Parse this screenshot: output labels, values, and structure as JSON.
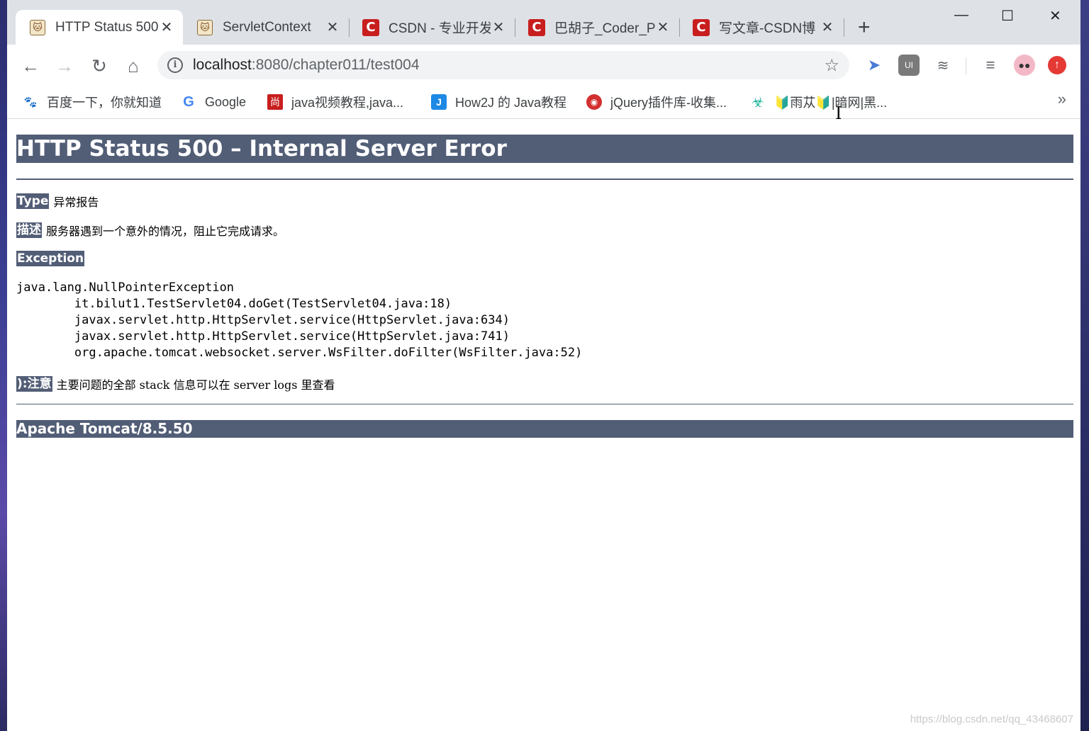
{
  "browser": {
    "tabs": [
      {
        "title": "HTTP Status 500",
        "icon": "tomcat-cat-icon",
        "active": true
      },
      {
        "title": "ServletContext",
        "icon": "tomcat-cat-icon",
        "active": false
      },
      {
        "title": "CSDN - 专业开发",
        "icon": "csdn-icon",
        "active": false
      },
      {
        "title": "巴胡子_Coder_P",
        "icon": "csdn-icon",
        "active": false
      },
      {
        "title": "写文章-CSDN博",
        "icon": "csdn-icon",
        "active": false
      }
    ],
    "new_tab": "+",
    "window_controls": {
      "minimize": "—",
      "maximize": "☐",
      "close": "✕"
    },
    "address": {
      "host": "localhost",
      "path": ":8080/chapter011/test004"
    },
    "bookmarks": [
      {
        "label": "百度一下，你就知道",
        "icon": "baidu-paw-icon"
      },
      {
        "label": "Google",
        "icon": "google-g-icon"
      },
      {
        "label": "java视频教程,java...",
        "icon": "shang-icon"
      },
      {
        "label": "How2J 的 Java教程",
        "icon": "how2j-icon"
      },
      {
        "label": "jQuery插件库-收集...",
        "icon": "jquery-lib-icon"
      },
      {
        "label": "🔰雨苁🔰|暗网|黑...",
        "icon": "biohazard-icon"
      }
    ],
    "bookmarks_overflow": "»"
  },
  "page": {
    "title": "HTTP Status 500 – Internal Server Error",
    "type_label": "Type",
    "type_value": "异常报告",
    "desc_label": "描述",
    "desc_value": "服务器遇到一个意外的情况，阻止它完成请求。",
    "exception_label": "Exception",
    "stack_trace": "java.lang.NullPointerException\n\tit.bilut1.TestServlet04.doGet(TestServlet04.java:18)\n\tjavax.servlet.http.HttpServlet.service(HttpServlet.java:634)\n\tjavax.servlet.http.HttpServlet.service(HttpServlet.java:741)\n\torg.apache.tomcat.websocket.server.WsFilter.doFilter(WsFilter.java:52)",
    "note_label": "):注意",
    "note_value": "主要问题的全部 stack 信息可以在 server logs 里查看",
    "footer": "Apache Tomcat/8.5.50"
  },
  "watermark": "https://blog.csdn.net/qq_43468607",
  "colors": {
    "tomcat_header": "#525d76",
    "tab_strip": "#dee1e6",
    "csdn_red": "#c81e1e"
  }
}
